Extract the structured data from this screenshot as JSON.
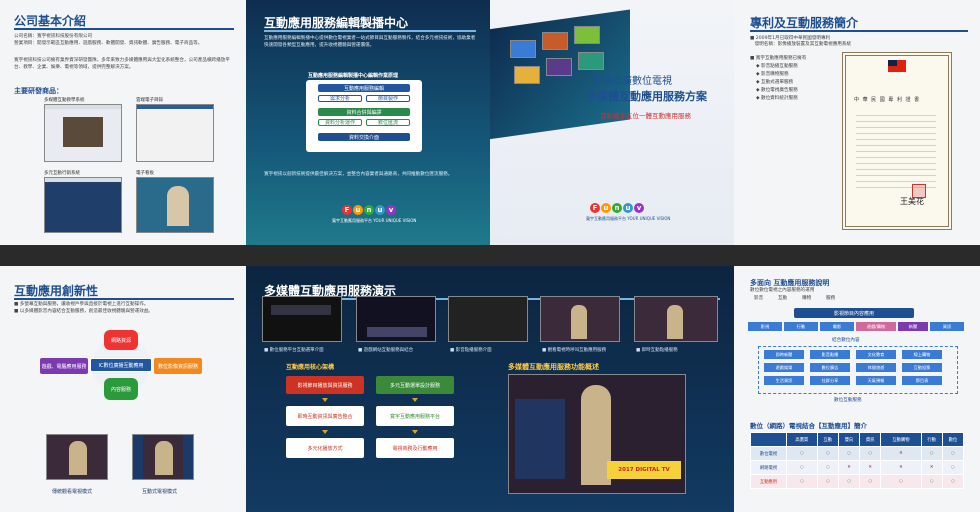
{
  "p1": {
    "title": "公司基本介紹",
    "company": "公司名稱：寬宇視訊科技股份有限公司",
    "business": "營業項目：開發示範區互動應用、遊戲服務、軟體開發、資訊軟體、廣告服務、電子商品等。",
    "para": "寬宇視訊科技公司擁有業界資深研發團隊，多年來致力多媒體應用與大型化系統整合，公司產品橫跨播放平台、教學、企業、娛樂、電視等領域，提供完整解決方案。",
    "sub": "主要研發商品：",
    "shots": [
      "多媒體互動教學系統",
      "雲端電子目錄",
      "多元互動行銷系統",
      "電子看板"
    ]
  },
  "p2": {
    "title": "互動應用服務編輯製播中心",
    "para1": "互動應用服務編輯製播中心提供數位電視業者一站式節目與互動服務製作，結合多元視訊技術，協助業者快速開發各類型互動應用，提升收視體驗與營運價值。",
    "flow_title": "互動應用服務編輯製播中心編輯作業原理",
    "flow": [
      "互動應用服務編輯",
      "需求分析",
      "節目製作",
      "資料合併與編譯",
      "資料分析運作",
      "數位匯流",
      "資料交換介面"
    ],
    "para2": "寬宇視訊以創新技術提供最佳解決方案，並整合內容業者與通路商，共同推動數位匯流服務。",
    "logo_sub": "寬宇互動應用服務平台 YOUR UNIQUE VISION"
  },
  "p3": {
    "line1": "協助推廣數位電視",
    "line2": "多媒體互動應用服務方案",
    "line3": "首創寬宇五位一體互動應用服務",
    "logo": [
      "F",
      "u",
      "n",
      "u",
      "v"
    ],
    "logo_sub": "寬宇互動應用服務平台 YOUR UNIQUE VISION"
  },
  "p4": {
    "title": "專利及互動服務簡介",
    "l1": "■ 2009年1月已取得中華民國發明專利",
    "l2": "　發明名稱：影像播放裝置及其互動電視應用系統",
    "items_title": "■ 寬宇互動應用服務已擁有",
    "items": [
      "◆ 影音點播互動服務",
      "◆ 影音購物服務",
      "◆ 互動式選單服務",
      "◆ 數位電視廣告服務",
      "◆ 數位資料統計服務"
    ],
    "cert": "中 華 民 國 專 利 證 書",
    "seal": "王美花"
  },
  "p5": {
    "title": "互動應用創新性",
    "l1": "■ 多螢幕互動與服務，讓收視戶參與直接於電視上進行互動操作。",
    "l2": "■ 以多媒體影音內容結合互動服務，創造最佳收視體驗與營運效益。",
    "center": "IC數位廣播互動應用",
    "top": "網路資源",
    "left": "遊戲、電腦應用服務",
    "right": "數位影像資訊服務",
    "bottom": "內容服務",
    "cap1": "傳統觀看電視模式",
    "cap2": "互動式電視模式"
  },
  "p6": {
    "title": "多媒體互動應用服務演示",
    "shots": [
      "■ 數位服務平台互動選單介面",
      "■ 遊戲網站互動服務與結合",
      "■ 影音點播服務介面",
      "■ 觀看電視時呼叫互動應用服務",
      "■ 即時互動點播服務"
    ],
    "flow_title": "互動應用核心架構",
    "flow": [
      "影視節目播放與資訊服務",
      "多元互動選單設計服務",
      "即時互動資訊與廣告整合",
      "寬宇互動應用服務平台",
      "多元化播放方式",
      "電視商務及行動應用"
    ],
    "demo_title": "多媒體互動應用服務功能概述",
    "banner": "2017 DIGITAL TV"
  },
  "p7": {
    "title": "多面向 互動應用服務說明",
    "intro": "數位數位電視之內容服務的運用",
    "legend": [
      "影音",
      "互動",
      "購物",
      "服務"
    ],
    "bar": [
      "影視",
      "行動",
      "電影",
      "遊戲/購物",
      "新聞",
      "資訊"
    ],
    "hub": "影視節目內容應用",
    "mid": "結合數位內容",
    "grid": [
      "即時新聞",
      "影音點播",
      "文化教育",
      "線上購物",
      "遊戲娛樂",
      "數位廣告",
      "休閒旅遊",
      "互動投票",
      "生活資訊",
      "社群分享",
      "天氣預報",
      "節目表"
    ],
    "bottom": "數位互動服務",
    "table_title": "數位（網路）電視結合【互動應用】簡介",
    "head": [
      "",
      "高畫質",
      "互動",
      "雙向",
      "資訊",
      "互動購物",
      "行動",
      "數位"
    ],
    "rows": [
      {
        "name": "數位電視",
        "vals": [
          "○",
          "○",
          "○",
          "○",
          "✕",
          "○",
          "○"
        ]
      },
      {
        "name": "網路電視",
        "vals": [
          "○",
          "○",
          "✕",
          "✕",
          "✕",
          "✕",
          "○"
        ]
      },
      {
        "name": "互動應用",
        "vals": [
          "○",
          "○",
          "○",
          "○",
          "○",
          "○",
          "○"
        ]
      }
    ],
    "colors": {
      "yes": "#3a8d3a",
      "no": "#8a2a2a",
      "accent": "#1d4f92"
    }
  }
}
